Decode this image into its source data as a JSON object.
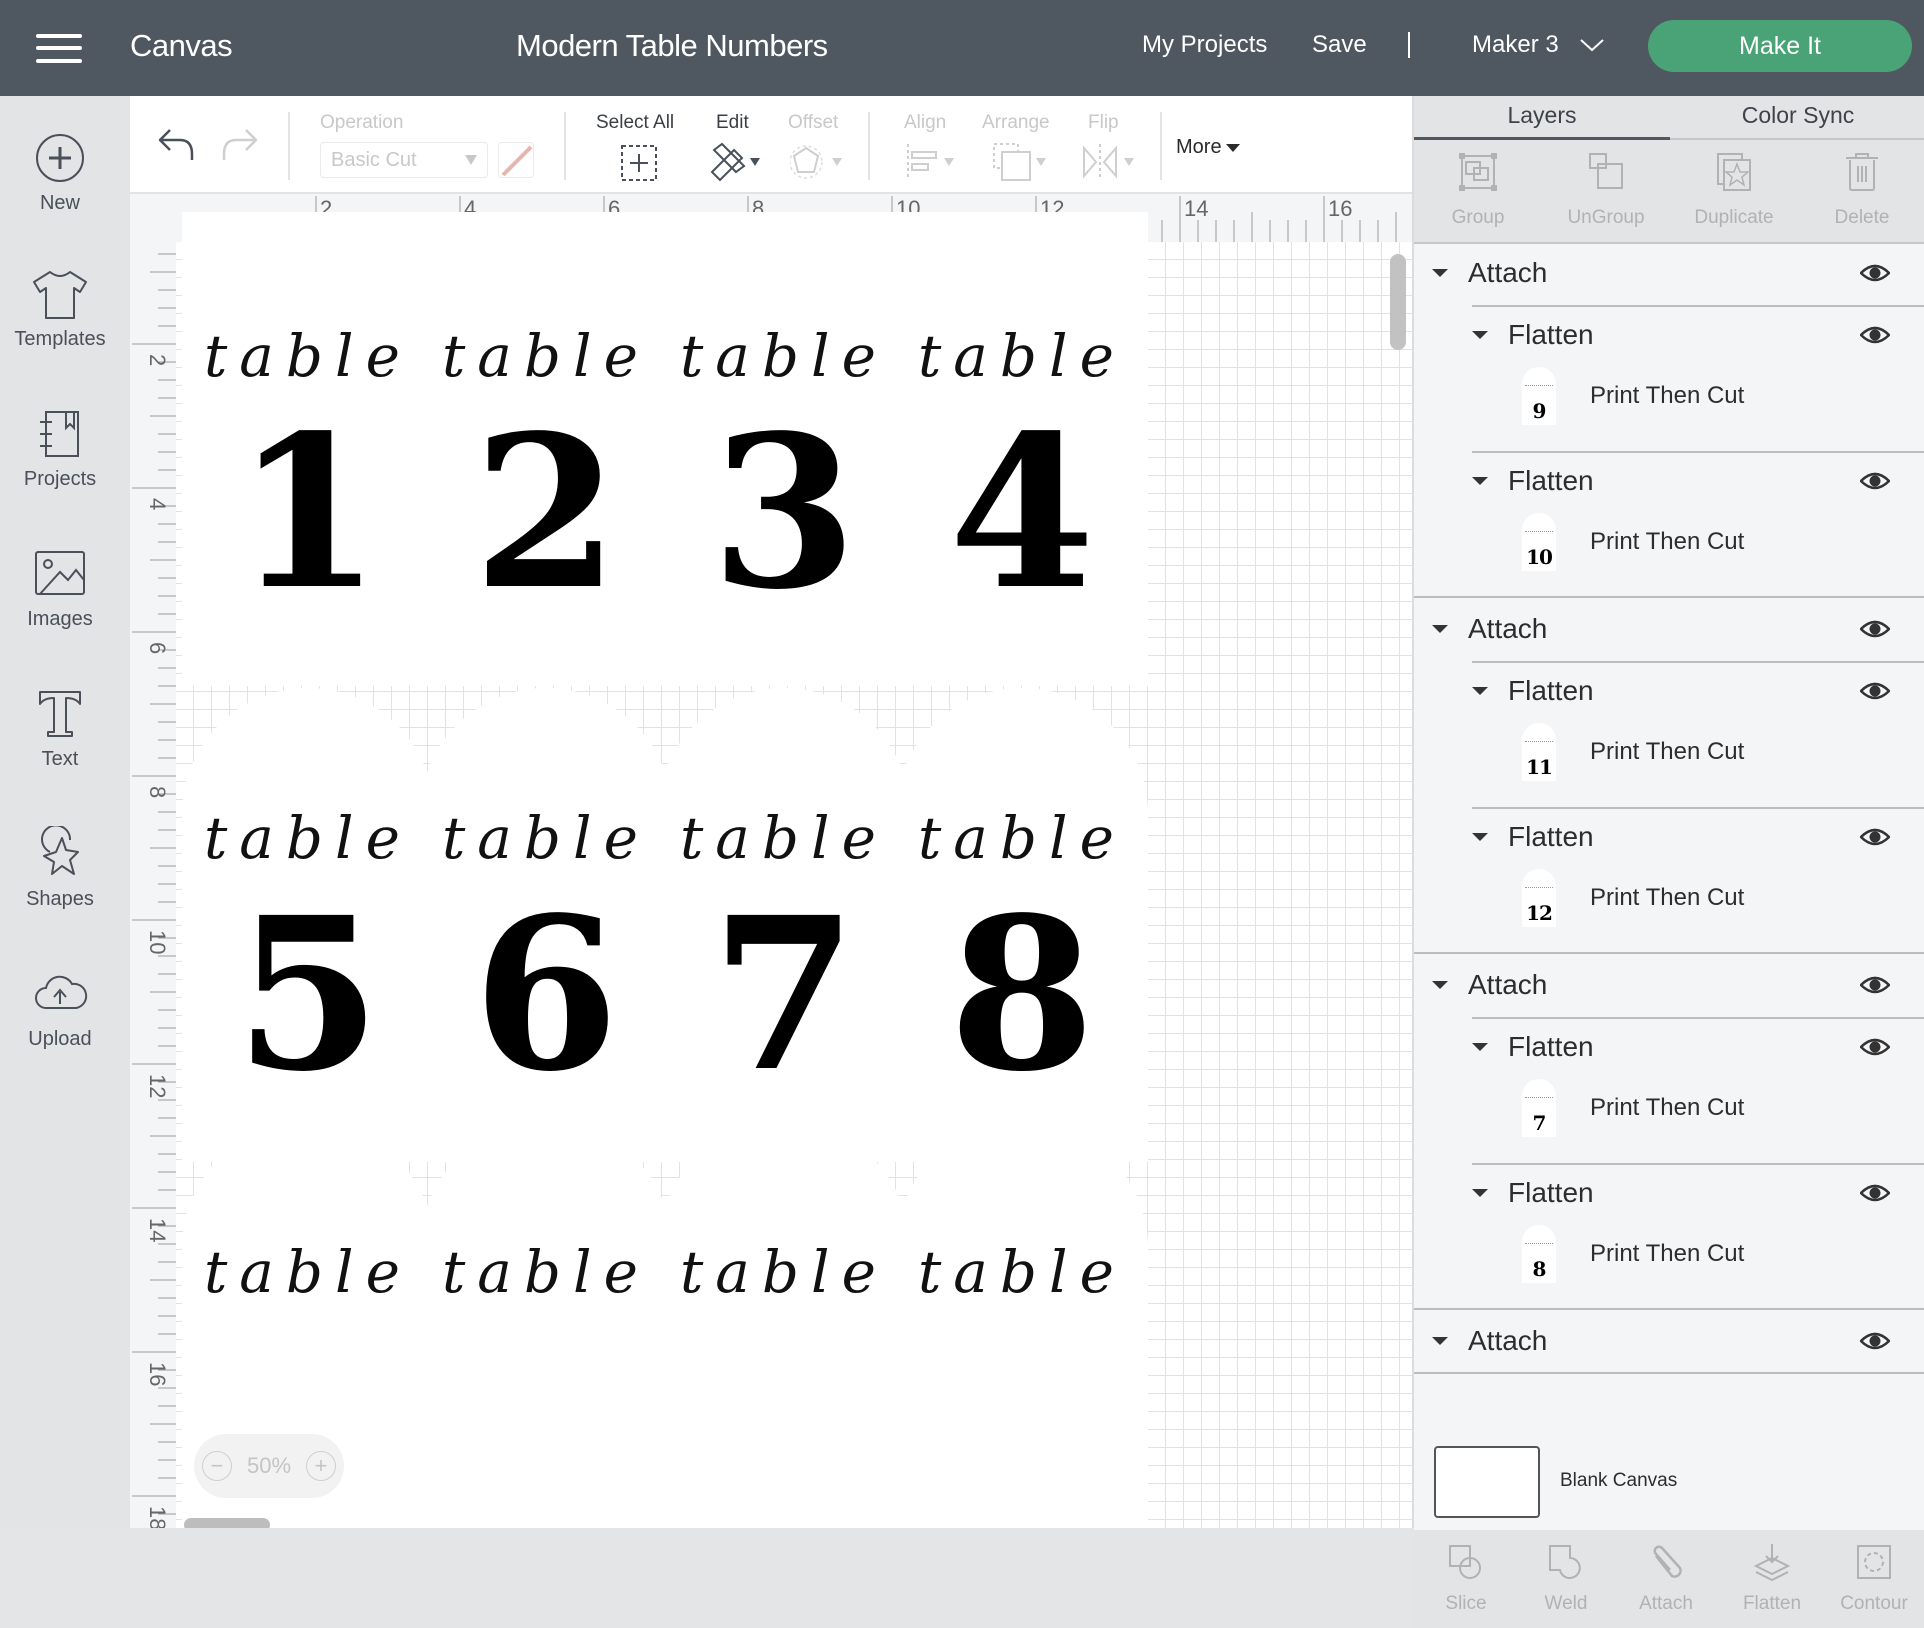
{
  "header": {
    "app_title": "Canvas",
    "project_title": "Modern Table Numbers",
    "my_projects": "My Projects",
    "save": "Save",
    "separator": "|",
    "machine": "Maker 3",
    "make_it": "Make It",
    "make_it_color": "#4aa377"
  },
  "sidebar": {
    "items": [
      {
        "label": "New",
        "icon": "plus-circle-icon"
      },
      {
        "label": "Templates",
        "icon": "tshirt-icon"
      },
      {
        "label": "Projects",
        "icon": "notebook-icon"
      },
      {
        "label": "Images",
        "icon": "image-icon"
      },
      {
        "label": "Text",
        "icon": "text-t-icon"
      },
      {
        "label": "Shapes",
        "icon": "shapes-icon"
      },
      {
        "label": "Upload",
        "icon": "cloud-upload-icon"
      }
    ]
  },
  "toolbar": {
    "operation_label": "Operation",
    "operation_value": "Basic Cut",
    "select_all": "Select All",
    "edit": "Edit",
    "offset": "Offset",
    "align": "Align",
    "arrange": "Arrange",
    "flip": "Flip",
    "more": "More"
  },
  "canvas": {
    "ruler_top": [
      "2",
      "4",
      "6",
      "8",
      "10",
      "12",
      "14",
      "16"
    ],
    "ruler_left": [
      "2",
      "4",
      "6",
      "8",
      "10",
      "12",
      "14",
      "16",
      "18"
    ],
    "cards": [
      {
        "script": "table",
        "number": "1"
      },
      {
        "script": "table",
        "number": "2"
      },
      {
        "script": "table",
        "number": "3"
      },
      {
        "script": "table",
        "number": "4"
      },
      {
        "script": "table",
        "number": "5"
      },
      {
        "script": "table",
        "number": "6"
      },
      {
        "script": "table",
        "number": "7"
      },
      {
        "script": "table",
        "number": "8"
      },
      {
        "script": "table",
        "number": ""
      },
      {
        "script": "table",
        "number": ""
      },
      {
        "script": "table",
        "number": ""
      },
      {
        "script": "table",
        "number": ""
      }
    ],
    "zoom": "50%",
    "zoom_out": "−",
    "zoom_in": "+"
  },
  "panel": {
    "tabs": [
      {
        "label": "Layers",
        "active": true
      },
      {
        "label": "Color Sync",
        "active": false
      }
    ],
    "actions": [
      {
        "label": "Group",
        "icon": "group-icon"
      },
      {
        "label": "UnGroup",
        "icon": "ungroup-icon"
      },
      {
        "label": "Duplicate",
        "icon": "duplicate-icon"
      },
      {
        "label": "Delete",
        "icon": "trash-icon"
      }
    ],
    "layers": [
      {
        "label": "Attach",
        "children": [
          {
            "label": "Flatten",
            "leaf": "Print Then Cut",
            "thumb": "9"
          },
          {
            "label": "Flatten",
            "leaf": "Print Then Cut",
            "thumb": "10"
          }
        ]
      },
      {
        "label": "Attach",
        "children": [
          {
            "label": "Flatten",
            "leaf": "Print Then Cut",
            "thumb": "11"
          },
          {
            "label": "Flatten",
            "leaf": "Print Then Cut",
            "thumb": "12"
          }
        ]
      },
      {
        "label": "Attach",
        "children": [
          {
            "label": "Flatten",
            "leaf": "Print Then Cut",
            "thumb": "7"
          },
          {
            "label": "Flatten",
            "leaf": "Print Then Cut",
            "thumb": "8"
          }
        ]
      },
      {
        "label": "Attach",
        "children": []
      }
    ],
    "blank_canvas": "Blank Canvas",
    "bottom_actions": [
      {
        "label": "Slice",
        "icon": "slice-icon"
      },
      {
        "label": "Weld",
        "icon": "weld-icon"
      },
      {
        "label": "Attach",
        "icon": "paperclip-icon"
      },
      {
        "label": "Flatten",
        "icon": "flatten-icon"
      },
      {
        "label": "Contour",
        "icon": "contour-icon"
      }
    ]
  }
}
